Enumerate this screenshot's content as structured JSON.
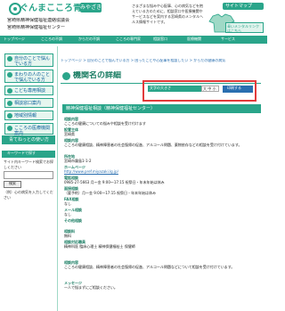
{
  "header": {
    "logo_text": "ぐんまこころ青",
    "logo_banner": "みやざき",
    "org_line_1": "宮崎県精神保健福祉連絡協議会",
    "org_line_2": "宮崎県精神保健福祉センター",
    "intro": "さまざまな悩みや心配事、心の病気などを抱えている方のために、相談窓口や医療機関やサービスなどを案内する宮崎県のメンタルヘルス情報サイトです。",
    "sitemap": "サイトマップ",
    "contact": "青いメンタルリンクはこちら"
  },
  "nav": [
    "トップページ",
    "こころの不調",
    "からだの不調",
    "こころの専門家",
    "相談窓口",
    "医療機関",
    "サービス"
  ],
  "sidebar": {
    "items": [
      "自分のことで悩んでいる方",
      "まわりの人のことで悩んでいる方",
      "こども専用相談",
      "相談窓口案内",
      "地域別情報",
      "こころの医療機関案内"
    ],
    "hit_title": "青てねっとの使い方",
    "search_title": "キーワードで探す",
    "search_desc": "サイト内キーワード検索でお探しください",
    "search_placeholder": "",
    "search_button": "検索",
    "search_note": "（例）心の病気を入力してください"
  },
  "breadcrumb": "トップページ > 自分のことで悩んでいる方 > 困ったことや心配事を相談したい > からだの健康の病気",
  "main": {
    "title": "機関名の詳細",
    "font_size_label": "文字の大きさ",
    "font_size_options": "大 中 小",
    "print": "印刷する",
    "heading": "精神保健福祉相談（精神保健福祉センター）",
    "fields": [
      {
        "label": "相談内容",
        "value": "こころの健康についての悩みや相談を受け付けます"
      },
      {
        "label": "設置主体",
        "value": "宮崎県"
      },
      {
        "label": "相談内容",
        "value": "こころの健康相談、精神障害者の社会復帰の促進、アルコール問題、薬物依存などの相談を受け付けています。"
      },
      {
        "label": "所在地",
        "value": "宮崎市霧島1-1-2"
      },
      {
        "label": "ホームページ",
        "value": "http://www.pref.miyazaki.lg.jp/"
      },
      {
        "label": "電話相談",
        "value": "0985-27-5663 月～金 9:00～17:15 祝祭日・年末年始は休み"
      },
      {
        "label": "面接相談",
        "value": "（要予約）月～金 9:00～17:15 祝祭日・年末年始は休み"
      },
      {
        "label": "FAX相談",
        "value": "なし"
      },
      {
        "label": "メール相談",
        "value": "なし"
      },
      {
        "label": "その他相談",
        "value": ""
      },
      {
        "label": "相談料",
        "value": "無料"
      },
      {
        "label": "相談対応職員",
        "value": "精神科医 臨床心理士 精神保健福祉士 保健師"
      },
      {
        "label": "相談内容",
        "value": "こころの健康相談、精神障害者の社会復帰の促進、アルコール問題などについて相談を受け付けています。"
      },
      {
        "label": "メッセージ",
        "value": "一人で悩まずにご相談ください。"
      }
    ]
  }
}
